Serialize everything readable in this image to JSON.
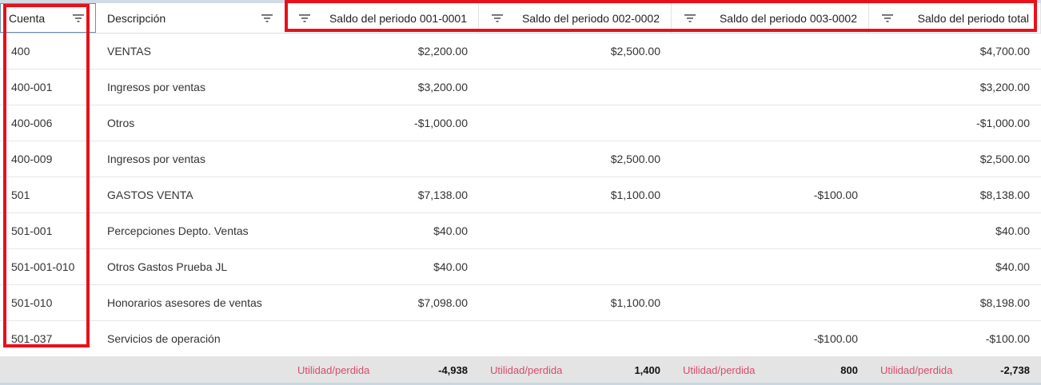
{
  "columns": [
    {
      "label": "Cuenta"
    },
    {
      "label": "Descripción"
    },
    {
      "label": "Saldo del periodo 001-0001"
    },
    {
      "label": "Saldo del periodo 002-0002"
    },
    {
      "label": "Saldo del periodo 003-0002"
    },
    {
      "label": "Saldo del periodo total"
    }
  ],
  "rows": [
    [
      "400",
      "VENTAS",
      "$2,200.00",
      "$2,500.00",
      "",
      "$4,700.00"
    ],
    [
      "400-001",
      "Ingresos por ventas",
      "$3,200.00",
      "",
      "",
      "$3,200.00"
    ],
    [
      "400-006",
      "Otros",
      "-$1,000.00",
      "",
      "",
      "-$1,000.00"
    ],
    [
      "400-009",
      "Ingresos por ventas",
      "",
      "$2,500.00",
      "",
      "$2,500.00"
    ],
    [
      "501",
      "GASTOS VENTA",
      "$7,138.00",
      "$1,100.00",
      "-$100.00",
      "$8,138.00"
    ],
    [
      "501-001",
      "Percepciones Depto. Ventas",
      "$40.00",
      "",
      "",
      "$40.00"
    ],
    [
      "501-001-010",
      "Otros Gastos Prueba JL",
      "$40.00",
      "",
      "",
      "$40.00"
    ],
    [
      "501-010",
      "Honorarios asesores de ventas",
      "$7,098.00",
      "$1,100.00",
      "",
      "$8,198.00"
    ],
    [
      "501-037",
      "Servicios de operación",
      "",
      "",
      "-$100.00",
      "-$100.00"
    ]
  ],
  "footer": [
    {
      "label": "Utilidad/perdida",
      "value": "-4,938"
    },
    {
      "label": "Utilidad/perdida",
      "value": "1,400"
    },
    {
      "label": "Utilidad/perdida",
      "value": "800"
    },
    {
      "label": "Utilidad/perdida",
      "value": "-2,738"
    }
  ],
  "icons": {
    "filter": "filter-icon"
  },
  "colors": {
    "highlight": "#e8101a",
    "footer_label": "#d94b6b",
    "footer_bg": "#e4e4e4"
  }
}
